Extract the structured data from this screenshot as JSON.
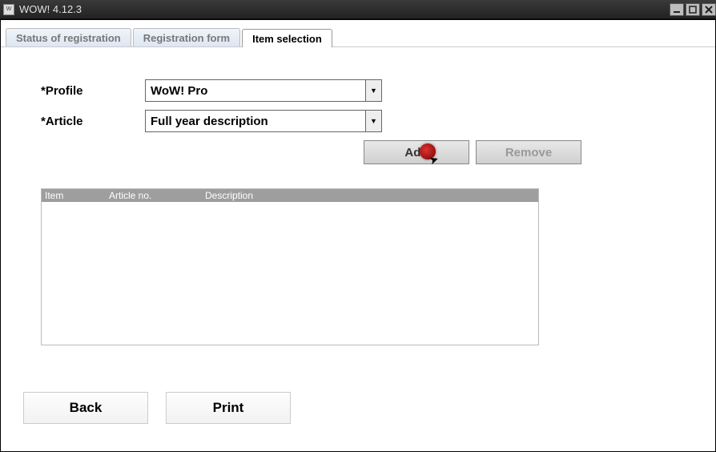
{
  "window": {
    "title": "WOW! 4.12.3"
  },
  "tabs": {
    "t0": "Status of registration",
    "t1": "Registration form",
    "t2": "Item selection"
  },
  "form": {
    "profile_label": "*Profile",
    "profile_value": "WoW! Pro",
    "article_label": "*Article",
    "article_value": "Full year description"
  },
  "buttons": {
    "add": "Add",
    "remove": "Remove",
    "back": "Back",
    "print": "Print"
  },
  "grid": {
    "headers": {
      "item": "Item",
      "article_no": "Article no.",
      "description": "Description"
    }
  }
}
